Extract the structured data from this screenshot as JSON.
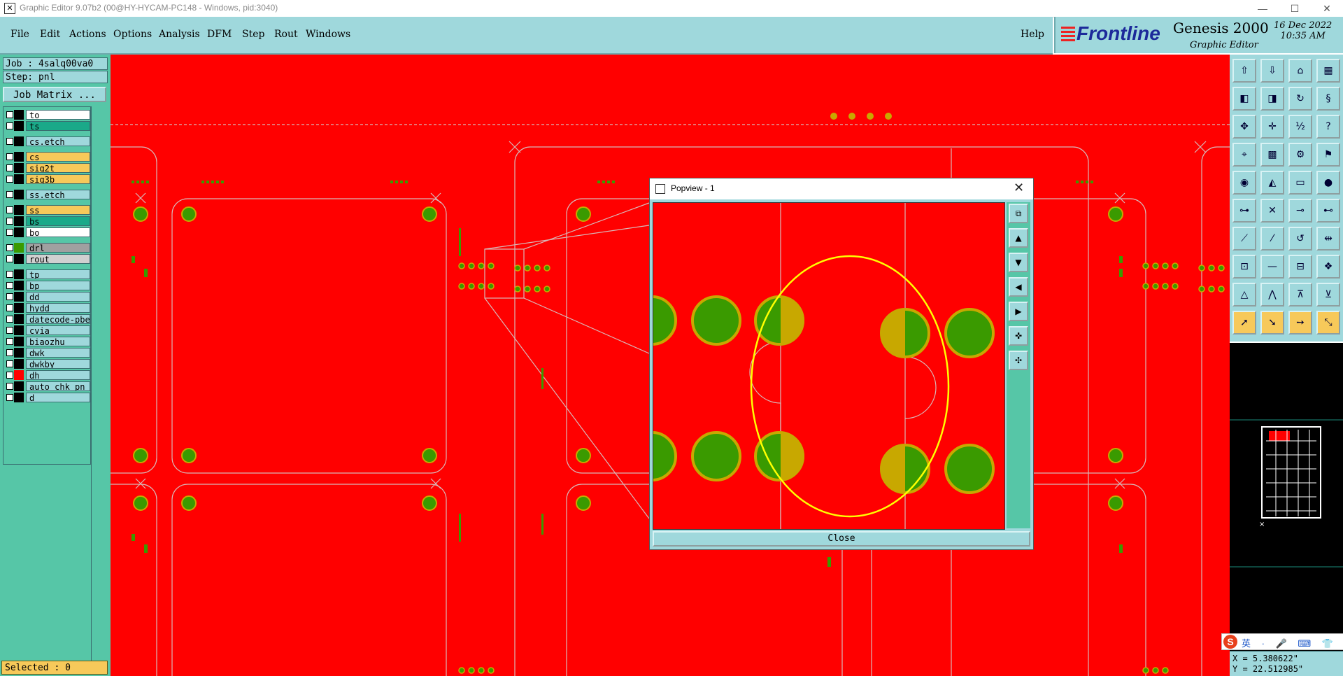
{
  "window": {
    "title": "Graphic Editor 9.07b2 (00@HY-HYCAM-PC148 - Windows, pid:3040)",
    "minimize": "—",
    "maximize": "☐",
    "close": "✕"
  },
  "menu": [
    "File",
    "Edit",
    "Actions",
    "Options",
    "Analysis",
    "DFM",
    "Step",
    "Rout",
    "Windows"
  ],
  "help": "Help",
  "brand": {
    "logo": "Frontline",
    "product": "Genesis 2000",
    "subtitle": "Graphic Editor",
    "date": "16 Dec 2022",
    "time": "10:35 AM"
  },
  "left": {
    "job": "Job : 4salq00va0",
    "step": "Step: pnl",
    "job_matrix": "Job Matrix ..."
  },
  "layers": [
    {
      "name": "to",
      "color": "#ffffff"
    },
    {
      "name": "ts",
      "color": "#1aa989"
    },
    {
      "name": "cs.etch",
      "color": "#9fd8dc"
    },
    {
      "name": "cs",
      "color": "#f7c95a"
    },
    {
      "name": "sig2t",
      "color": "#f7c95a"
    },
    {
      "name": "sig3b",
      "color": "#f7c95a"
    },
    {
      "name": "ss.etch",
      "color": "#9fd8dc"
    },
    {
      "name": "ss",
      "color": "#f7c95a"
    },
    {
      "name": "bs",
      "color": "#1aa989"
    },
    {
      "name": "bo",
      "color": "#ffffff"
    },
    {
      "name": "drl",
      "color": "#a0a0a0"
    },
    {
      "name": "rout",
      "color": "#d0d0d0"
    },
    {
      "name": "tp",
      "color": "#9fd8dc"
    },
    {
      "name": "bp",
      "color": "#9fd8dc"
    },
    {
      "name": "dd",
      "color": "#9fd8dc"
    },
    {
      "name": "hydd",
      "color": "#9fd8dc"
    },
    {
      "name": "datecode-pbe",
      "color": "#9fd8dc"
    },
    {
      "name": "cvia",
      "color": "#9fd8dc"
    },
    {
      "name": "biaozhu",
      "color": "#9fd8dc"
    },
    {
      "name": "dwk",
      "color": "#9fd8dc"
    },
    {
      "name": "dwkby",
      "color": "#9fd8dc"
    },
    {
      "name": "dh",
      "color": "#9fd8dc"
    },
    {
      "name": "auto_chk_pn",
      "color": "#9fd8dc"
    },
    {
      "name": "d",
      "color": "#9fd8dc"
    }
  ],
  "selected": "Selected : 0",
  "popview": {
    "title": "Popview - 1",
    "close_label": "Close",
    "close_x": "✕"
  },
  "coords": {
    "x": "X = 5.380622\"",
    "y": "Y = 22.512985\""
  },
  "ime": {
    "logo": "S",
    "text": "英 · 🎤 ⌨ 👕 ⊞"
  },
  "colors": {
    "canvas": "#ff0000",
    "pad_green": "#3a9a00",
    "pad_ring": "#c8a800",
    "panel": "#9fd8dc",
    "accent": "#56c6a7"
  }
}
